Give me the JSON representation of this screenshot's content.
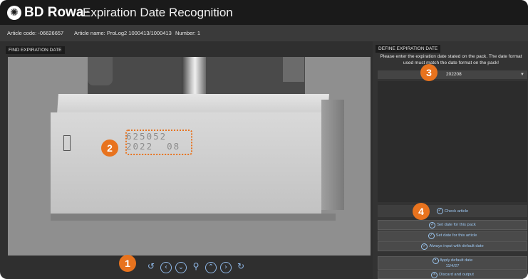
{
  "header": {
    "brand": "BD Rowa",
    "tm": "™",
    "title": "Expiration Date Recognition"
  },
  "info": {
    "article_code": "Article code: -06626657",
    "article_name": "Article name: ProLog2 1000413/1000413",
    "number": "Number: 1"
  },
  "left_panel": {
    "tab": "FIND EXPIRATION DATE",
    "printed_code_line1": "625052",
    "printed_code_line2": "2022  08",
    "toolbar_icons": [
      "rotate-icon",
      "previous-icon",
      "down-icon",
      "zoom-icon",
      "up-icon",
      "next-icon",
      "redo-icon"
    ]
  },
  "right_panel": {
    "tab": "DEFINE EXPIRATION DATE",
    "instruction": "Please enter the expiration date stated on the pack. The date format used must match the date format on the pack!",
    "selected_date": "202208",
    "buttons": {
      "check": "Check article",
      "set_pack": "Set date for this pack",
      "set_article": "Set date for this article",
      "always_default": "Always input with default date",
      "apply_default": "Apply default date",
      "apply_default_date": "11/4/27",
      "discard": "Discard and output"
    }
  },
  "badges": {
    "b1": "1",
    "b2": "2",
    "b3": "3",
    "b4": "4"
  },
  "colors": {
    "accent": "#e8731e",
    "button_text": "#9cc7f2"
  }
}
